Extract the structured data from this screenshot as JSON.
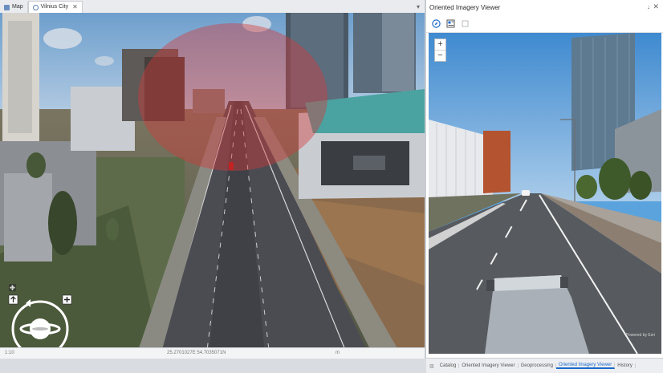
{
  "map_window": {
    "tabs": [
      {
        "label": "Map",
        "icon": "map-icon"
      },
      {
        "label": "Vilnius City",
        "icon": "globe-icon"
      }
    ],
    "status": {
      "scale": "1:10",
      "coords": "25.2701027E 54.7035071N",
      "units": "m"
    }
  },
  "viewer": {
    "title": "Oriented Imagery Viewer",
    "pin_symbol": "↓",
    "close_symbol": "✕",
    "toolbar_icons": [
      "compass-icon",
      "image-list-icon",
      "layers-icon"
    ],
    "zoom_in": "+",
    "zoom_out": "−",
    "footer": "Powered by Esri"
  },
  "bottom_tabs": [
    "Catalog",
    "Oriented Imagery Viewer",
    "Geoprocessing",
    "Oriented Imagery Viewer",
    "History"
  ],
  "active_bottom_tab": 3,
  "colors": {
    "accent": "#1b6ac9",
    "coverage": "#d43a3a",
    "sky": "#6faee2"
  }
}
